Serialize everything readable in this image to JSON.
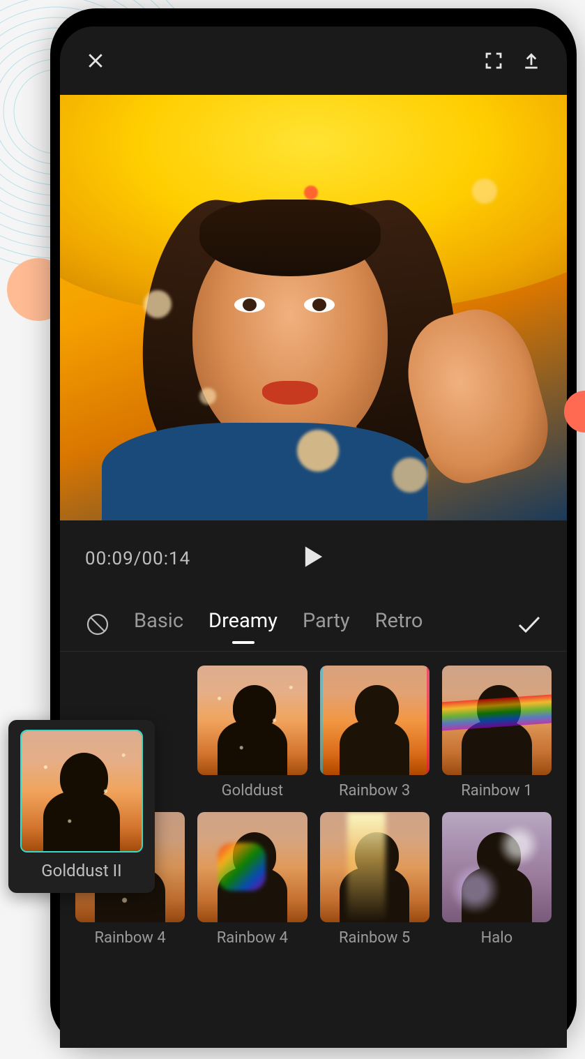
{
  "playback": {
    "current_time": "00:09",
    "total_time": "00:14",
    "time_display": "00:09/00:14"
  },
  "categories": {
    "items": [
      "Basic",
      "Dreamy",
      "Party",
      "Retro"
    ],
    "active_index": 1
  },
  "selected_filter": {
    "label": "Golddust II"
  },
  "filters": [
    {
      "label": "Golddust",
      "variant": "golddust"
    },
    {
      "label": "Rainbow 3",
      "variant": "rainbow3"
    },
    {
      "label": "Rainbow 1",
      "variant": "rainbow1"
    },
    {
      "label": "Rainbow 4",
      "variant": "rainbow4a"
    },
    {
      "label": "Rainbow 4",
      "variant": "rainbow4b"
    },
    {
      "label": "Rainbow 5",
      "variant": "rainbow5"
    },
    {
      "label": "Halo",
      "variant": "halo"
    }
  ]
}
